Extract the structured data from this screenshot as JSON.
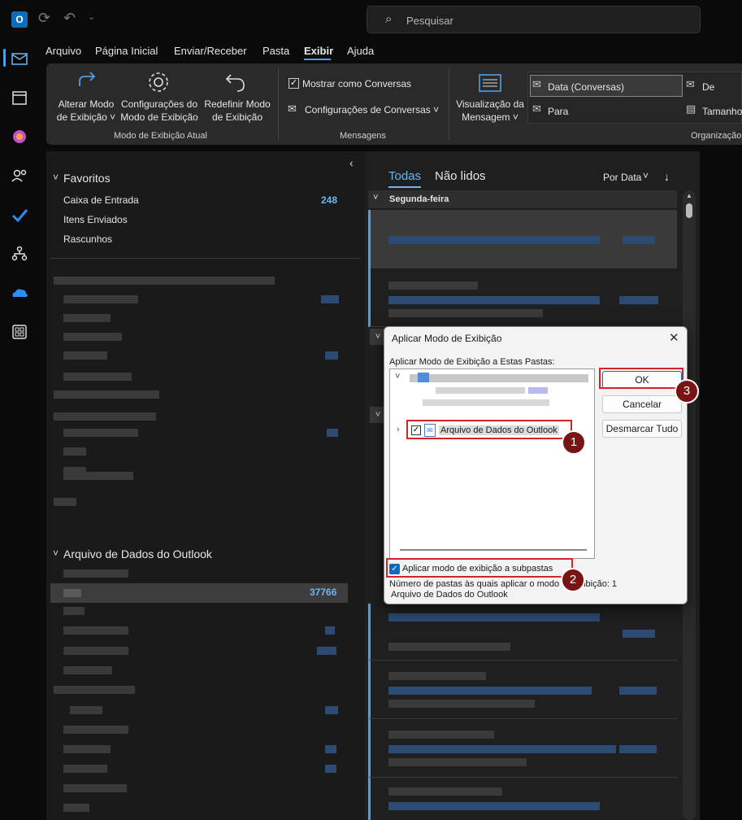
{
  "search": {
    "placeholder": "Pesquisar"
  },
  "menu": [
    "Arquivo",
    "Página Inicial",
    "Enviar/Receber",
    "Pasta",
    "Exibir",
    "Ajuda"
  ],
  "ribbon": {
    "alterar1": "Alterar Modo",
    "alterar2": "de Exibição ˅",
    "config1": "Configurações do",
    "config2": "Modo de Exibição",
    "redef1": "Redefinir Modo",
    "redef2": "de Exibição",
    "group1": "Modo de Exibição Atual",
    "mostrar": "Mostrar como Conversas",
    "configconv": "Configurações de Conversas ˅",
    "group2": "Mensagens",
    "vis1": "Visualização da",
    "vis2": "Mensagem ˅",
    "data": "Data (Conversas)",
    "de": "De",
    "para": "Para",
    "tamanho": "Tamanho",
    "group3": "Organização"
  },
  "folders": {
    "favoritos": "Favoritos",
    "caixa": "Caixa de Entrada",
    "caixa_count": "248",
    "enviados": "Itens Enviados",
    "rascunhos": "Rascunhos",
    "arquivo_dados": "Arquivo de Dados do Outlook",
    "selected_count": "37766"
  },
  "msglist": {
    "tab_all": "Todas",
    "tab_unread": "Não lidos",
    "sort": "Por Data",
    "group": "Segunda-feira"
  },
  "dialog": {
    "title": "Aplicar Modo de Exibição",
    "subtitle": "Aplicar Modo de Exibição a Estas Pastas:",
    "tree_item": "Arquivo de Dados do Outlook",
    "ok": "OK",
    "cancel": "Cancelar",
    "uncheck_all": "Desmarcar Tudo",
    "subfolders": "Aplicar modo de exibição a subpastas",
    "count_text": "Número de pastas às quais aplicar o modo de exibição: 1",
    "footer": "Arquivo de Dados do Outlook"
  },
  "badges": [
    "1",
    "2",
    "3"
  ],
  "colors": {
    "accent": "#4f9ee6",
    "badge": "#7a1414",
    "highlight": "#d62424"
  }
}
